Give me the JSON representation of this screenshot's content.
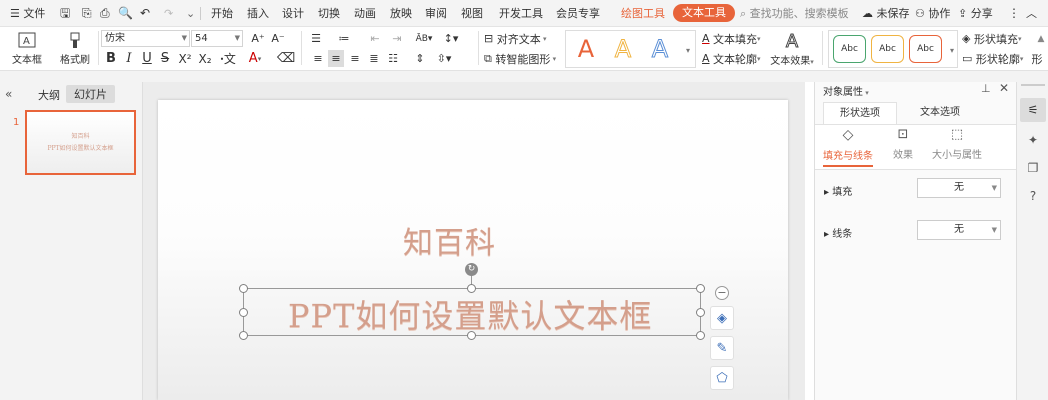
{
  "topbar": {
    "menu_label": "文件",
    "tabs": [
      "开始",
      "插入",
      "设计",
      "切换",
      "动画",
      "放映",
      "审阅",
      "视图",
      "开发工具",
      "会员专享"
    ],
    "context_tab_drawing": "绘图工具",
    "context_tab_text": "文本工具",
    "search_placeholder": "查找功能、搜索模板",
    "unsaved": "未保存",
    "collab": "协作",
    "share": "分享"
  },
  "ribbon": {
    "textbox_label": "文本框",
    "format_painter_label": "格式刷",
    "font_name": "仿宋",
    "font_size": "54",
    "align_text": "对齐文本",
    "smart_art": "转智能图形",
    "text_fill": "文本填充",
    "text_outline": "文本轮廓",
    "text_effect": "文本效果",
    "wordart_sample": "A",
    "shape_style_sample": "Abc",
    "shape_fill": "形状填充",
    "shape_outline": "形状轮廓",
    "overflow_label": "形"
  },
  "left_panel": {
    "tab_outline": "大纲",
    "tab_slides": "幻灯片",
    "slide_number": "1",
    "thumb_title": "知百科",
    "thumb_subtitle": "PPT如何设置默认文本框"
  },
  "slide": {
    "title": "知百科",
    "subtitle": "PPT如何设置默认文本框"
  },
  "right_panel": {
    "header": "对象属性",
    "tab_shape": "形状选项",
    "tab_text": "文本选项",
    "sub_fill_line": "填充与线条",
    "sub_effect": "效果",
    "sub_size": "大小与属性",
    "fill_label": "填充",
    "fill_value": "无",
    "line_label": "线条",
    "line_value": "无"
  },
  "colors": {
    "accent": "#e8643a",
    "slide_text": "#d49f8c"
  }
}
